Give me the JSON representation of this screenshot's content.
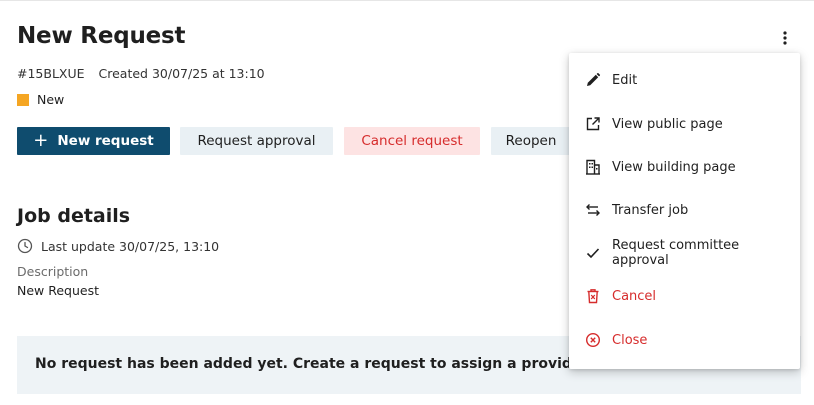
{
  "header": {
    "title": "New Request",
    "reference": "#15BLXUE",
    "created": "Created 30/07/25 at 13:10",
    "status_label": "New",
    "menu_icon": "kebab-menu-icon"
  },
  "actions": {
    "new_request": "New request",
    "request_approval": "Request approval",
    "cancel_request": "Cancel request",
    "reopen": "Reopen"
  },
  "job_details": {
    "title": "Job details",
    "last_update": "Last update 30/07/25, 13:10",
    "description_label": "Description",
    "description_value": "New Request"
  },
  "banner": {
    "message": "No request has been added yet. Create a request to assign a provider."
  },
  "menu": {
    "items": [
      {
        "label": "Edit",
        "icon": "pencil-icon"
      },
      {
        "label": "View public page",
        "icon": "external-link-icon"
      },
      {
        "label": "View building page",
        "icon": "building-icon"
      },
      {
        "label": "Transfer job",
        "icon": "transfer-icon"
      },
      {
        "label": "Request committee approval",
        "icon": "check-icon"
      },
      {
        "label": "Cancel",
        "icon": "trash-icon"
      },
      {
        "label": "Close",
        "icon": "close-circle-icon"
      }
    ]
  },
  "colors": {
    "primary": "#0f4c6e",
    "status_new": "#f5a623",
    "danger": "#d62c2c",
    "light_button": "#e9f0f4",
    "danger_button": "#fde3e3",
    "banner_bg": "#eef3f6"
  }
}
